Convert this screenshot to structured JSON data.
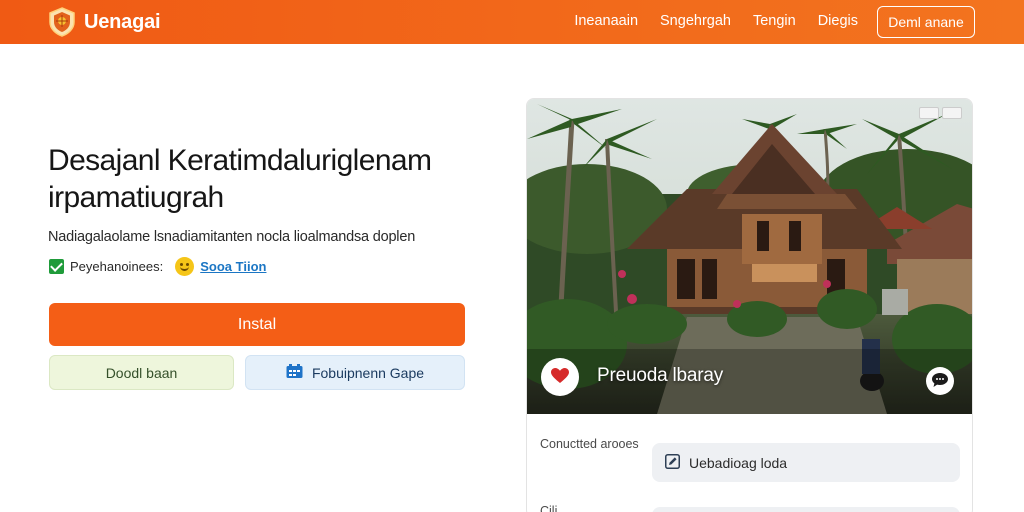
{
  "header": {
    "brand": "Uenagai",
    "nav": [
      "Ineanaain",
      "Sngehrgah",
      "Tengin",
      "Diegis"
    ],
    "cta": "Deml anane",
    "accent": "#f05a14"
  },
  "hero": {
    "title_line1": "Desajanl Keratimdaluriglenam",
    "title_line2": "irpamatiugrah",
    "subtitle": "Nadiagalaolame lsnadiamitanten nocla lioalmandsa doplen",
    "check_label": "Peyehanoinees:",
    "link_label": "Sooa Tiion",
    "install_label": "Instal",
    "secondary_green": "Doodl baan",
    "secondary_blue": "Fobuipnenn Gape"
  },
  "card": {
    "caption": "Preuoda lbaray",
    "field1_label": "Conuctted arooes",
    "field1_value": "Uebadioag loda",
    "field2_label": "Cili"
  },
  "icons": {
    "logo": "shield-logo-icon",
    "check": "checkbox-icon",
    "emoji": "smile-icon",
    "blue_button": "grid-icon",
    "heart": "heart-icon",
    "chat": "chat-icon",
    "field": "edit-icon"
  }
}
